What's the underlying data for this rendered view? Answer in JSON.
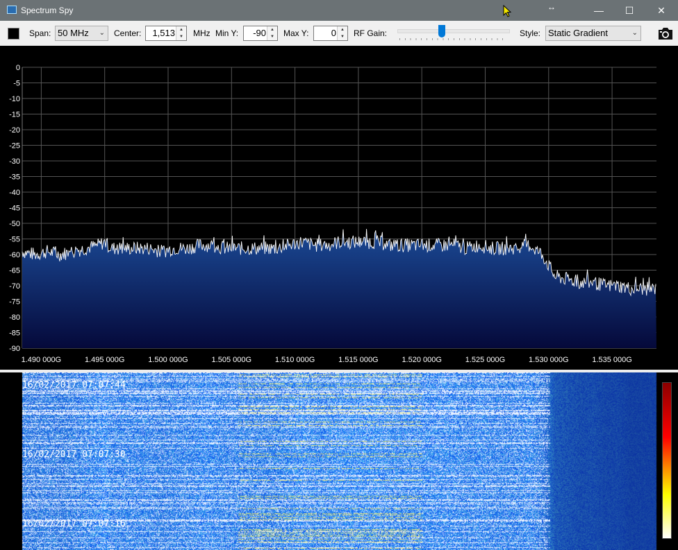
{
  "window": {
    "title": "Spectrum Spy",
    "resize_hint": "↔",
    "minimize": "—",
    "maximize": "☐",
    "close": "✕"
  },
  "toolbar": {
    "span_label": "Span:",
    "span_value": "50 MHz",
    "center_label": "Center:",
    "center_value": "1,513",
    "center_unit": "MHz",
    "miny_label": "Min Y:",
    "miny_value": "-90",
    "maxy_label": "Max Y:",
    "maxy_value": "0",
    "rfgain_label": "RF Gain:",
    "rfgain_level_fraction": 0.39,
    "style_label": "Style:",
    "style_value": "Static Gradient",
    "camera_icon": "camera-icon"
  },
  "chart_data": {
    "type": "area",
    "title": "",
    "xlabel": "",
    "ylabel": "",
    "xlim": [
      1.4885,
      1.5385
    ],
    "ylim": [
      -90,
      0
    ],
    "y_ticks": [
      "0",
      "-5",
      "-10",
      "-15",
      "-20",
      "-25",
      "-30",
      "-35",
      "-40",
      "-45",
      "-50",
      "-55",
      "-60",
      "-65",
      "-70",
      "-75",
      "-80",
      "-85",
      "-90"
    ],
    "x_ticks": [
      "1.490 000G",
      "1.495 000G",
      "1.500 000G",
      "1.505 000G",
      "1.510 000G",
      "1.515 000G",
      "1.520 000G",
      "1.525 000G",
      "1.530 000G",
      "1.535 000G"
    ],
    "x_tick_values": [
      1.49,
      1.495,
      1.5,
      1.505,
      1.51,
      1.515,
      1.52,
      1.525,
      1.53,
      1.535
    ],
    "grid": true,
    "x": [
      1.4885,
      1.4895,
      1.4905,
      1.4915,
      1.4925,
      1.4935,
      1.4945,
      1.495,
      1.4955,
      1.4965,
      1.4975,
      1.4985,
      1.4995,
      1.5005,
      1.5015,
      1.5025,
      1.5035,
      1.5045,
      1.5055,
      1.5065,
      1.5075,
      1.5085,
      1.5095,
      1.5105,
      1.5115,
      1.5125,
      1.5135,
      1.5145,
      1.5155,
      1.5165,
      1.5175,
      1.5185,
      1.5195,
      1.5205,
      1.5215,
      1.5225,
      1.5235,
      1.5245,
      1.5255,
      1.5265,
      1.5275,
      1.5285,
      1.5295,
      1.5305,
      1.5315,
      1.5325,
      1.5335,
      1.5345,
      1.5355,
      1.5365,
      1.5375,
      1.5385
    ],
    "y": [
      -59,
      -60,
      -59,
      -60,
      -59,
      -58,
      -57,
      -56,
      -58,
      -58,
      -58,
      -58,
      -59,
      -58,
      -58,
      -57,
      -57,
      -58,
      -58,
      -58,
      -58,
      -58,
      -57,
      -56,
      -57,
      -57,
      -56,
      -56,
      -56,
      -56,
      -57,
      -57,
      -57,
      -57,
      -57,
      -57,
      -58,
      -57,
      -58,
      -58,
      -58,
      -57,
      -60,
      -67,
      -68,
      -69,
      -69,
      -70,
      -70,
      -71,
      -71,
      -71
    ],
    "line_color": "#ffffff",
    "fill_top": "#1b4a96",
    "fill_bottom": "#05093a"
  },
  "waterfall": {
    "timestamps": [
      "16/02/2017 07:07:44",
      "16/02/2017 07:07:30",
      "16/02/2017 07:07:16"
    ],
    "colorbar": [
      "#ffffff",
      "#ffff00",
      "#ff8c00",
      "#ff0000",
      "#8b0000"
    ]
  }
}
